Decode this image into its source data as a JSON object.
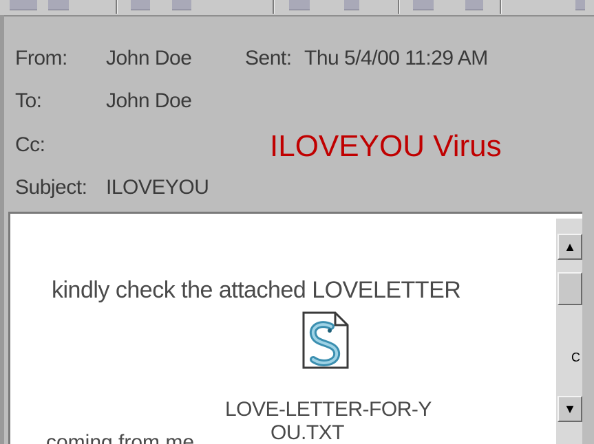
{
  "header": {
    "from_label": "From:",
    "from_value": "John Doe",
    "sent_label": "Sent:",
    "sent_value": "Thu 5/4/00 11:29 AM",
    "to_label": "To:",
    "to_value": "John Doe",
    "cc_label": "Cc:",
    "subject_label": "Subject:",
    "subject_value": "ILOVEYOU"
  },
  "overlay": {
    "title": "ILOVEYOU Virus",
    "title_color": "#c00000"
  },
  "message": {
    "body_text": "kindly check the attached LOVELETTER",
    "attachment_name_line1": "LOVE-LETTER-FOR-Y",
    "attachment_name_line2": "OU.TXT",
    "closing_text": "coming from me.",
    "attachment_icon": "script-file-icon"
  },
  "scrollbar": {
    "up_icon": "scroll-up-arrow-icon",
    "down_icon": "scroll-down-arrow-icon",
    "side_letter": "C"
  }
}
